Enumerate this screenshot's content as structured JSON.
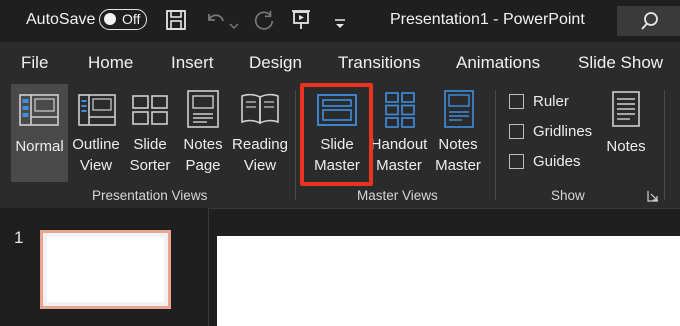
{
  "titlebar": {
    "autosave_label": "AutoSave",
    "autosave_state": "Off",
    "document_title": "Presentation1 - PowerPoint"
  },
  "tabs": [
    "File",
    "Home",
    "Insert",
    "Design",
    "Transitions",
    "Animations",
    "Slide Show"
  ],
  "ribbon": {
    "presentation_views": {
      "group_label": "Presentation Views",
      "normal": "Normal",
      "outline_view": [
        "Outline",
        "View"
      ],
      "slide_sorter": [
        "Slide",
        "Sorter"
      ],
      "notes_page": [
        "Notes",
        "Page"
      ],
      "reading_view": [
        "Reading",
        "View"
      ]
    },
    "master_views": {
      "group_label": "Master Views",
      "slide_master": [
        "Slide",
        "Master"
      ],
      "handout_master": [
        "Handout",
        "Master"
      ],
      "notes_master": [
        "Notes",
        "Master"
      ]
    },
    "show": {
      "group_label": "Show",
      "ruler": "Ruler",
      "gridlines": "Gridlines",
      "guides": "Guides",
      "notes": "Notes"
    }
  },
  "slides": {
    "current_slide_number": "1"
  },
  "colors": {
    "highlight": "#e8331f",
    "icon_blue": "#3d8fe0",
    "thumb_border": "#e9a590"
  },
  "icons": [
    "save-icon",
    "undo-icon",
    "redo-icon",
    "present-icon",
    "customize-qat-icon",
    "search-icon"
  ]
}
